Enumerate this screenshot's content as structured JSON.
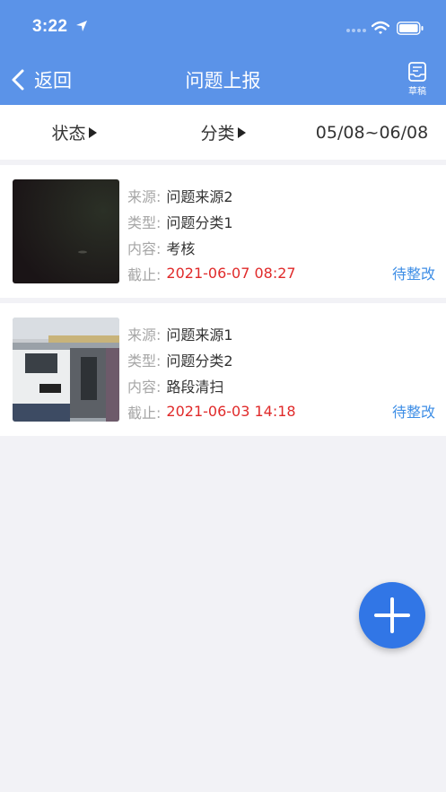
{
  "status_bar": {
    "time": "3:22"
  },
  "nav": {
    "back_label": "返回",
    "title": "问题上报",
    "draft_label": "草稿"
  },
  "filters": {
    "status_label": "状态",
    "category_label": "分类",
    "date_range": "05/08~06/08"
  },
  "field_labels": {
    "source": "来源:",
    "type": "类型:",
    "content": "内容:",
    "deadline": "截止:"
  },
  "items": [
    {
      "source": "问题来源2",
      "type": "问题分类1",
      "content": "考核",
      "deadline": "2021-06-07 08:27",
      "status": "待整改"
    },
    {
      "source": "问题来源1",
      "type": "问题分类2",
      "content": "路段清扫",
      "deadline": "2021-06-03 14:18",
      "status": "待整改"
    }
  ],
  "colors": {
    "header": "#5b93e8",
    "deadline": "#e02a2a",
    "status": "#3e8ee6",
    "fab": "#3176e6"
  }
}
